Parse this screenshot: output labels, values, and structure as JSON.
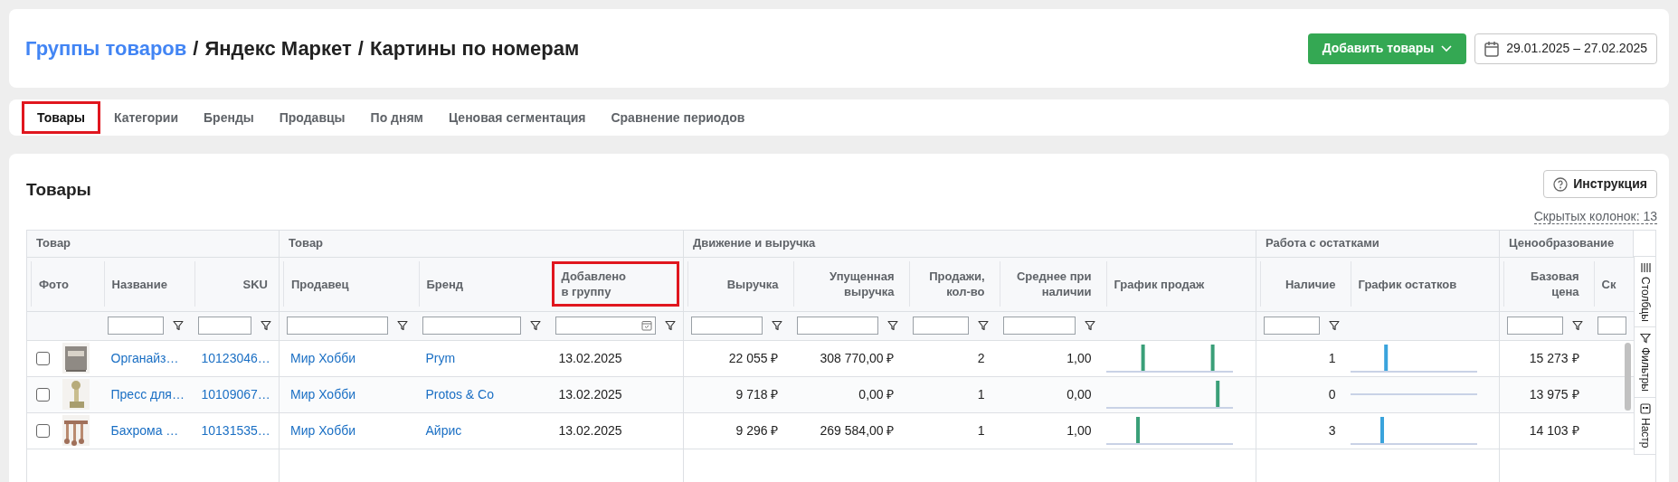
{
  "breadcrumb": {
    "link": "Группы товаров",
    "separator_1": "/",
    "part_1": "Яндекс Маркет",
    "separator_2": "/",
    "part_2": "Картины по номерам"
  },
  "add_button": {
    "label": "Добавить товары"
  },
  "date_range": {
    "value": "29.01.2025 – 27.02.2025"
  },
  "tabs": [
    {
      "label": "Товары",
      "selected": true,
      "highlighted": true
    },
    {
      "label": "Категории",
      "selected": false,
      "highlighted": false
    },
    {
      "label": "Бренды",
      "selected": false,
      "highlighted": false
    },
    {
      "label": "Продавцы",
      "selected": false,
      "highlighted": false
    },
    {
      "label": "По дням",
      "selected": false,
      "highlighted": false
    },
    {
      "label": "Ценовая сегментация",
      "selected": false,
      "highlighted": false
    },
    {
      "label": "Сравнение периодов",
      "selected": false,
      "highlighted": false
    }
  ],
  "section": {
    "title": "Товары",
    "help_button": "Инструкция",
    "hidden_columns": "Скрытых колонок: 13"
  },
  "column_groups": [
    {
      "label": "Товар"
    },
    {
      "label": "Товар"
    },
    {
      "label": "Движение и выручка"
    },
    {
      "label": "Работа с остатками"
    },
    {
      "label": "Ценообразование"
    }
  ],
  "columns": [
    {
      "label": "Фото",
      "highlighted": false
    },
    {
      "label": "Название",
      "kind": "link",
      "highlighted": false
    },
    {
      "label": "SKU",
      "kind": "link",
      "highlighted": false
    },
    {
      "label": "Продавец",
      "kind": "link",
      "highlighted": false
    },
    {
      "label": "Бренд",
      "kind": "link",
      "highlighted": false
    },
    {
      "label": "Добавлено в группу",
      "kind": "date",
      "highlighted": true
    },
    {
      "label": "Выручка",
      "kind": "number",
      "highlighted": false
    },
    {
      "label": "Упущенная выручка",
      "kind": "number",
      "highlighted": false
    },
    {
      "label": "Продажи, кол-во",
      "kind": "number",
      "highlighted": false
    },
    {
      "label": "Среднее при наличии",
      "kind": "number",
      "highlighted": false
    },
    {
      "label": "График продаж",
      "kind": "sales-chart",
      "highlighted": false
    },
    {
      "label": "Наличие",
      "kind": "number",
      "highlighted": false
    },
    {
      "label": "График остатков",
      "kind": "stock-chart",
      "highlighted": false
    },
    {
      "label": "Базовая цена",
      "kind": "number",
      "highlighted": false
    },
    {
      "label": "Ск",
      "kind": "number",
      "highlighted": false
    }
  ],
  "rows": [
    {
      "checked": false,
      "cells": [
        "Органайз…",
        "10123046…",
        "Мир Хобби",
        "Prym",
        "13.02.2025",
        "22 055 ₽",
        "308 770,00 ₽",
        "2",
        "1,00",
        "1",
        "15 273 ₽"
      ]
    },
    {
      "checked": false,
      "cells": [
        "Пресс для…",
        "10109067…",
        "Мир Хобби",
        "Protos & Co",
        "13.02.2025",
        "9 718 ₽",
        "0,00 ₽",
        "1",
        "0,00",
        "0",
        "13 975 ₽"
      ]
    },
    {
      "checked": false,
      "cells": [
        "Бахрома …",
        "10131535…",
        "Мир Хобби",
        "Айрис",
        "13.02.2025",
        "9 296 ₽",
        "269 584,00 ₽",
        "1",
        "1,00",
        "3",
        "14 103 ₽"
      ]
    }
  ],
  "side_tabs": [
    {
      "label": "Столбцы",
      "kind": "columns"
    },
    {
      "label": "Фильтры",
      "kind": "filters"
    },
    {
      "label": "Настр",
      "kind": "settings"
    }
  ]
}
